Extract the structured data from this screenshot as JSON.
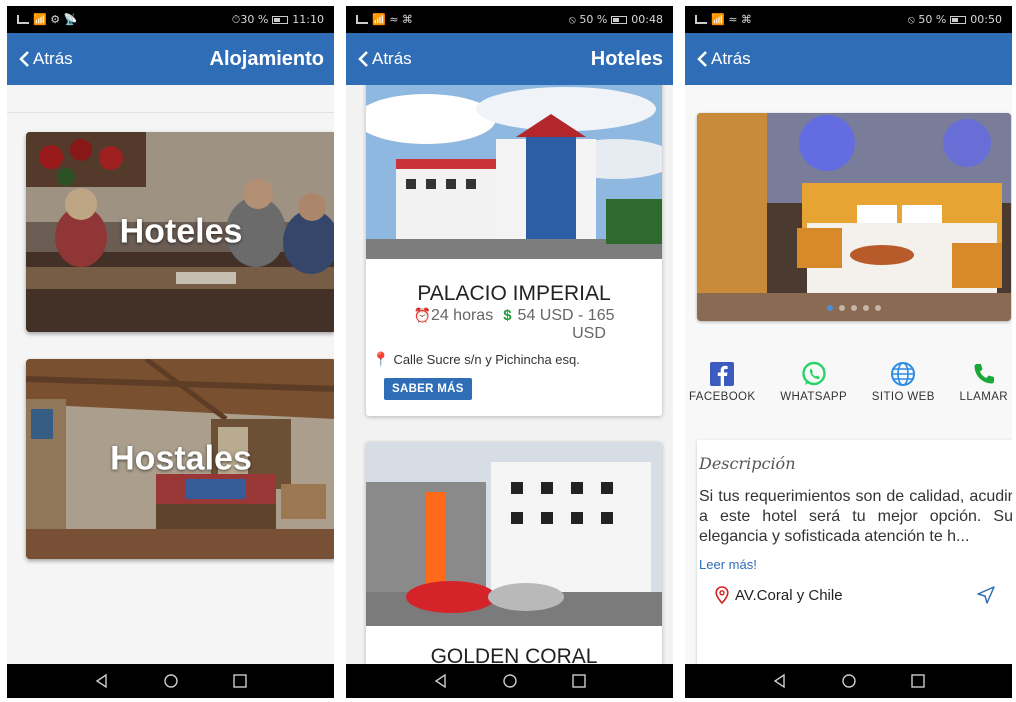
{
  "colors": {
    "primary": "#2f6db6",
    "whatsapp": "#25d366",
    "facebook": "#3b5bbf",
    "web": "#2b8be6",
    "call": "#1aa839"
  },
  "screens": [
    {
      "status": {
        "left": "📶 ⚙ 📡",
        "right": "⏱30 %",
        "time": "11:10"
      },
      "back_label": "Atrás",
      "title": "Alojamiento",
      "categories": [
        "Hoteles",
        "Hostales"
      ]
    },
    {
      "status": {
        "left": "📶 ≈ ⌘",
        "right": "⦸ 50 %",
        "time": "00:48"
      },
      "back_label": "Atrás",
      "title": "Hoteles",
      "hotels": [
        {
          "name": "PALACIO IMPERIAL",
          "hours": "24 horas",
          "price_line1": "54 USD - 165",
          "price_line2": "USD",
          "address": "Calle Sucre s/n y Pichincha esq.",
          "button": "SABER MÁS"
        },
        {
          "name": "GOLDEN CORAL"
        }
      ]
    },
    {
      "status": {
        "left": "📶 ≈ ⌘",
        "right": "⦸ 50 %",
        "time": "00:50"
      },
      "back_label": "Atrás",
      "social": {
        "facebook": "FACEBOOK",
        "whatsapp": "WHATSAPP",
        "web": "SITIO WEB",
        "call": "LLAMAR"
      },
      "description": {
        "title": "Descripción",
        "text": "Si tus requerimientos son de calidad, acudir a este hotel será tu mejor opción. Su elegancia y sofisticada atención te h...",
        "more": "Leer más!",
        "address": "AV.Coral y Chile"
      }
    }
  ]
}
